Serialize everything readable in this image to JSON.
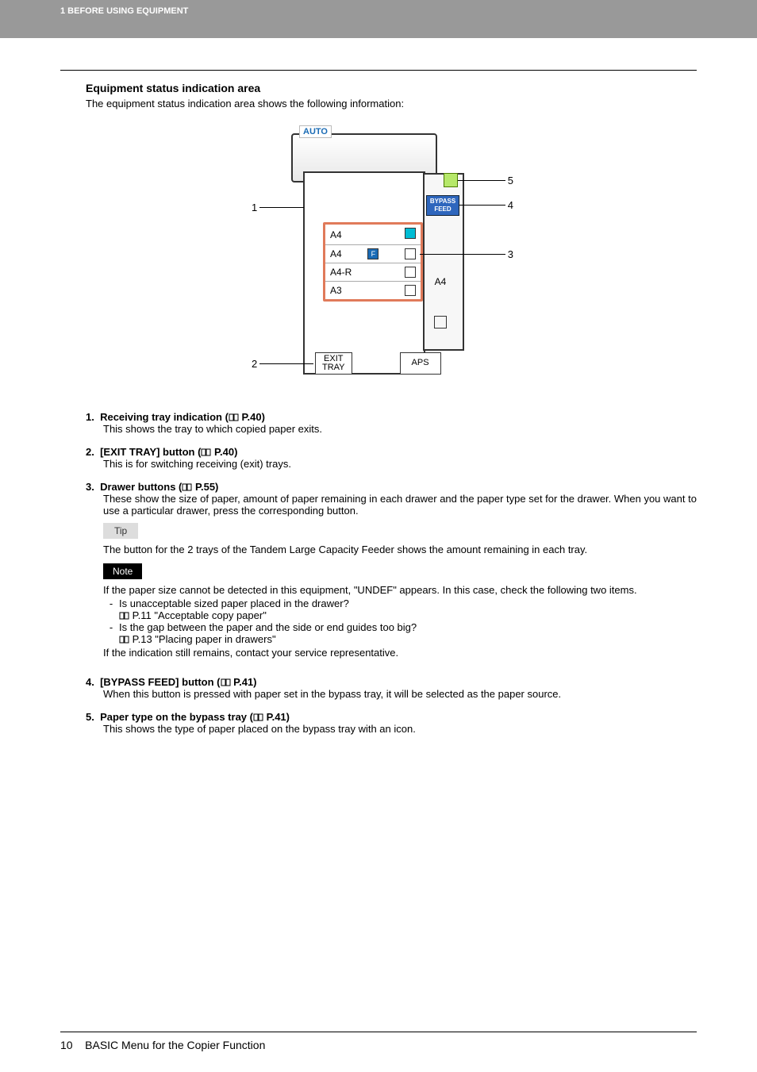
{
  "header": {
    "chapter": "1 BEFORE USING EQUIPMENT"
  },
  "section": {
    "title": "Equipment status indication area",
    "intro": "The equipment status indication area shows the following information:"
  },
  "diagram": {
    "auto": "AUTO",
    "bypass": "BYPASS\nFEED",
    "trays": [
      {
        "size": "A4",
        "iconset": "cde"
      },
      {
        "size": "A4",
        "iconset": "f"
      },
      {
        "size": "A4-R",
        "iconset": "bar"
      },
      {
        "size": "A3",
        "iconset": "bar"
      }
    ],
    "side_size": "A4",
    "exit": "EXIT\nTRAY",
    "aps": "APS",
    "callouts": {
      "n1": "1",
      "n2": "2",
      "n3": "3",
      "n4": "4",
      "n5": "5"
    }
  },
  "items": [
    {
      "num": "1.",
      "title_lead": "Receiving tray indication (",
      "page": " P.40)",
      "body": "This shows the tray to which copied paper exits."
    },
    {
      "num": "2.",
      "title_lead": "[EXIT TRAY] button (",
      "page": " P.40)",
      "body": "This is for switching receiving (exit) trays."
    },
    {
      "num": "3.",
      "title_lead": "Drawer buttons (",
      "page": " P.55)",
      "body": "These show the size of paper, amount of paper remaining in each drawer and the paper type set for the drawer. When you want to use a particular drawer, press the corresponding button.",
      "tip_label": "Tip",
      "tip_text": "The button for the 2 trays of the Tandem Large Capacity Feeder shows the amount remaining in each tray.",
      "note_label": "Note",
      "note_intro": "If the paper size cannot be detected in this equipment, \"UNDEF\" appears. In this case, check the following two items.",
      "note_bullets": [
        {
          "q": "Is unacceptable sized paper placed in the drawer?",
          "ref": " P.11 \"Acceptable copy paper\""
        },
        {
          "q": "Is the gap between the paper and the side or end guides too big?",
          "ref": " P.13 \"Placing paper in drawers\""
        }
      ],
      "note_outro": "If the indication still remains, contact your service representative."
    },
    {
      "num": "4.",
      "title_lead": "[BYPASS FEED] button (",
      "page": " P.41)",
      "body": "When this button is pressed with paper set in the bypass tray, it will be selected as the paper source."
    },
    {
      "num": "5.",
      "title_lead": "Paper type on the bypass tray (",
      "page": " P.41)",
      "body": "This shows the type of paper placed on the bypass tray with an icon."
    }
  ],
  "footer": {
    "page_num": "10",
    "title": "BASIC Menu for the Copier Function"
  }
}
